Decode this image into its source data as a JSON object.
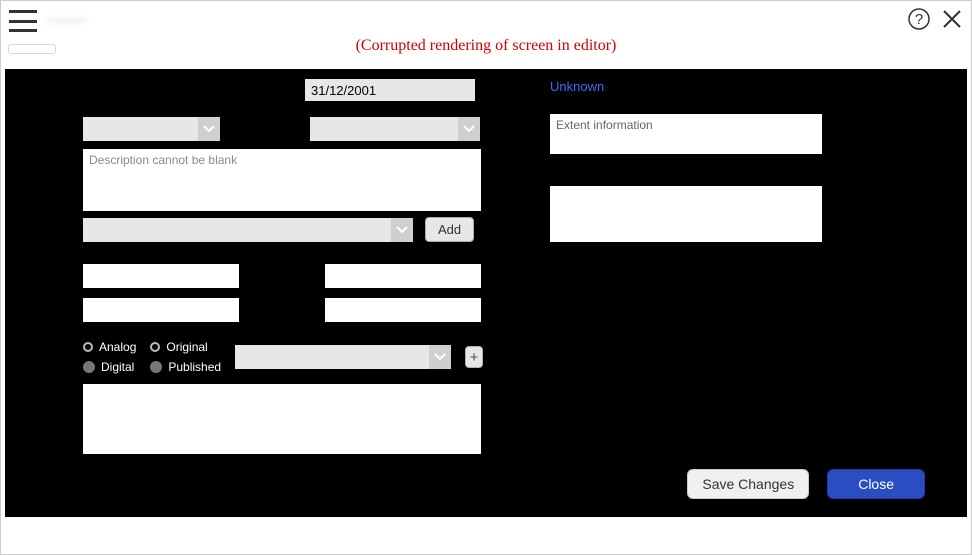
{
  "topbar": {
    "title": "———"
  },
  "banner": {
    "message": "(Corrupted rendering of screen in editor)"
  },
  "editor": {
    "date_value": "31/12/2001",
    "dd1_value": "",
    "dd2_value": "",
    "description_placeholder": "Description cannot be blank",
    "dd_add_value": "",
    "add_button": "Add",
    "radios": {
      "analog": "Analog",
      "digital": "Digital",
      "original": "Original",
      "published": "Published"
    },
    "dd_radio_value": ""
  },
  "right": {
    "unknown_link": "Unknown",
    "extent_placeholder": "Extent information"
  },
  "footer": {
    "save": "Save Changes",
    "close": "Close"
  }
}
